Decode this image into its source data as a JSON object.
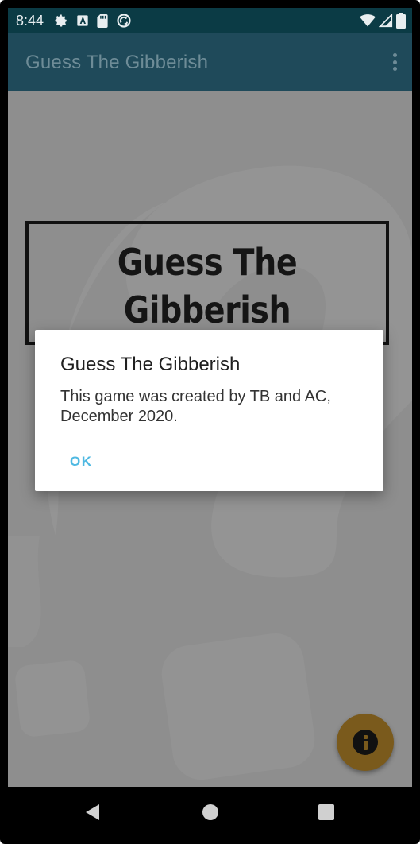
{
  "status_bar": {
    "time": "8:44",
    "icons_left": [
      "gear-icon",
      "font-a-icon",
      "sd-card-icon",
      "sync-circle-icon"
    ],
    "icons_right": [
      "wifi-icon",
      "signal-icon",
      "battery-icon"
    ]
  },
  "app_bar": {
    "title": "Guess The Gibberish",
    "menu_icon": "more-vert-icon"
  },
  "main": {
    "title_line1": "Guess The",
    "title_line2": "Gibberish",
    "fab_icon": "info-icon"
  },
  "dialog": {
    "title": "Guess The Gibberish",
    "message": "This game was created by TB and AC, December 2020.",
    "ok_label": "OK"
  },
  "nav_bar": {
    "icons": [
      "back-icon",
      "home-icon",
      "recents-icon"
    ]
  },
  "colors": {
    "status_bar": "#0b3b45",
    "app_bar": "#1f4a5a",
    "accent": "#4fb9e2",
    "fab": "#7a5a1c",
    "background_scrim": "#8e8e8e"
  }
}
